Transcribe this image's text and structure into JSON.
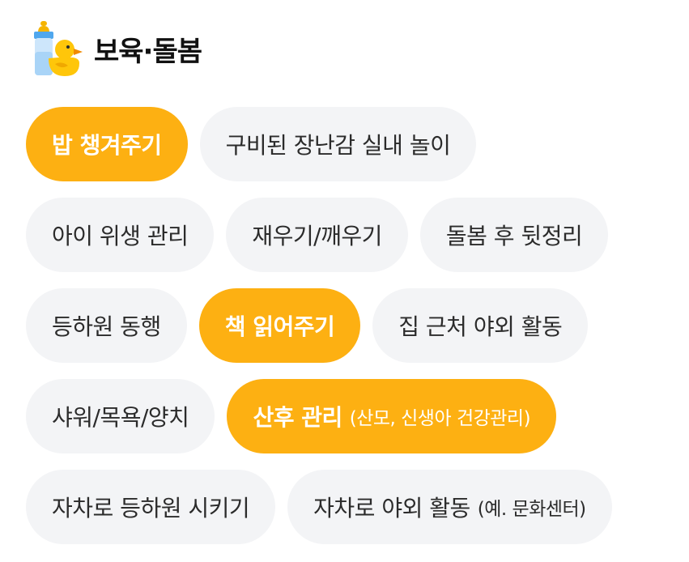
{
  "header": {
    "icon": "baby-bottle-duck-icon",
    "title": "보육·돌봄"
  },
  "colors": {
    "selected_bg": "#fdb012",
    "unselected_bg": "#f3f4f6",
    "unselected_text": "#2b2b2b"
  },
  "rows": [
    {
      "chips": [
        {
          "label": "밥 챙겨주기",
          "selected": true
        },
        {
          "label": "구비된 장난감 실내 놀이",
          "selected": false
        }
      ]
    },
    {
      "chips": [
        {
          "label": "아이 위생 관리",
          "selected": false
        },
        {
          "label": "재우기/깨우기",
          "selected": false
        },
        {
          "label": "돌봄 후 뒷정리",
          "selected": false
        }
      ]
    },
    {
      "chips": [
        {
          "label": "등하원 동행",
          "selected": false
        },
        {
          "label": "책 읽어주기",
          "selected": true
        },
        {
          "label": "집 근처 야외 활동",
          "selected": false
        }
      ]
    },
    {
      "chips": [
        {
          "label": "샤워/목욕/양치",
          "selected": false
        },
        {
          "label": "산후 관리",
          "sub": "(산모, 신생아 건강관리)",
          "selected": true
        }
      ]
    },
    {
      "chips": [
        {
          "label": "자차로 등하원 시키기",
          "selected": false
        },
        {
          "label": "자차로 야외 활동",
          "sub": "(예. 문화센터)",
          "selected": false
        }
      ]
    }
  ]
}
